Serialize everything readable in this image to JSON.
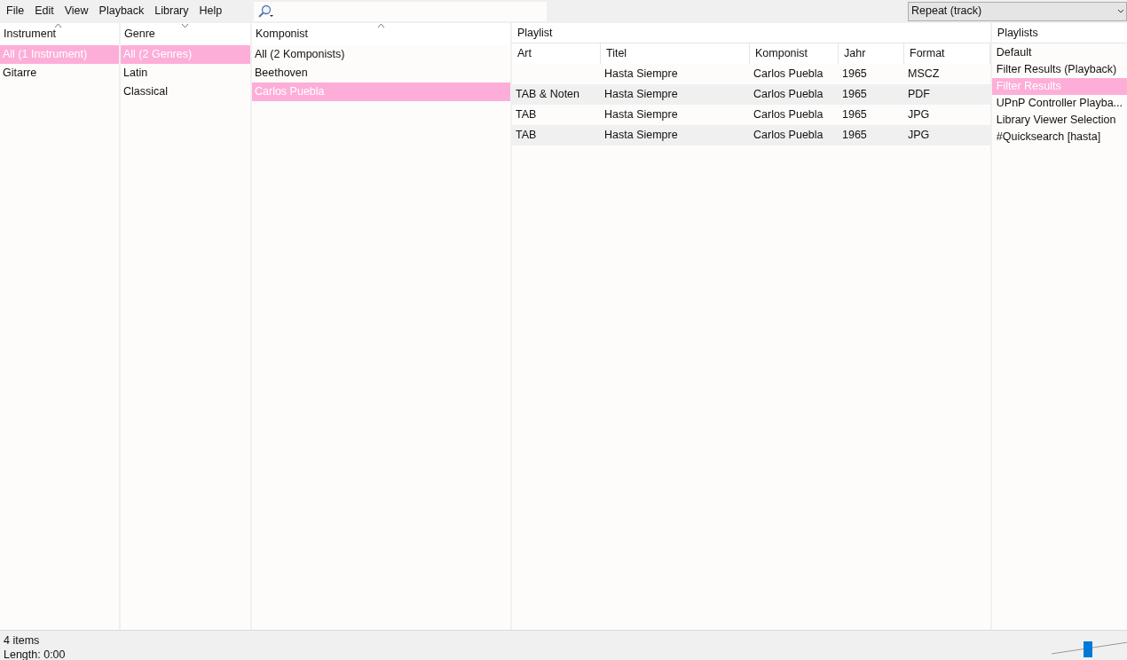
{
  "menu": [
    "File",
    "Edit",
    "View",
    "Playback",
    "Library",
    "Help"
  ],
  "repeat_dropdown": {
    "value": "Repeat (track)"
  },
  "filters": [
    {
      "title": "Instrument",
      "sort_ascending": true,
      "items": [
        {
          "label": "All (1 Instrument)",
          "selected": true
        },
        {
          "label": "Gitarre",
          "selected": false
        }
      ]
    },
    {
      "title": "Genre",
      "sort_ascending": false,
      "items": [
        {
          "label": "All (2 Genres)",
          "selected": true
        },
        {
          "label": "Latin",
          "selected": false
        },
        {
          "label": "Classical",
          "selected": false
        }
      ]
    },
    {
      "title": "Komponist",
      "sort_ascending": true,
      "items": [
        {
          "label": "All (2 Komponists)",
          "selected": false
        },
        {
          "label": "Beethoven",
          "selected": false
        },
        {
          "label": "Carlos Puebla",
          "selected": true
        }
      ]
    }
  ],
  "playlist": {
    "title": "Playlist",
    "columns": [
      "Art",
      "Titel",
      "Komponist",
      "Jahr",
      "Format"
    ],
    "rows": [
      [
        "",
        "Hasta Siempre",
        "Carlos Puebla",
        "1965",
        "MSCZ"
      ],
      [
        "TAB & Noten",
        "Hasta Siempre",
        "Carlos Puebla",
        "1965",
        "PDF"
      ],
      [
        "TAB",
        "Hasta Siempre",
        "Carlos Puebla",
        "1965",
        "JPG"
      ],
      [
        "TAB",
        "Hasta Siempre",
        "Carlos Puebla",
        "1965",
        "JPG"
      ]
    ]
  },
  "playlists": {
    "title": "Playlists",
    "items": [
      {
        "label": "Default",
        "selected": false
      },
      {
        "label": "Filter Results (Playback)",
        "selected": false
      },
      {
        "label": "Filter Results",
        "selected": true
      },
      {
        "label": "UPnP Controller Playba...",
        "selected": false
      },
      {
        "label": "Library Viewer Selection",
        "selected": false
      },
      {
        "label": "#Quicksearch [hasta]",
        "selected": false
      }
    ]
  },
  "status_bar": {
    "items": "4 items",
    "length": "Length: 0:00"
  },
  "volume": {
    "level": 0.47
  }
}
